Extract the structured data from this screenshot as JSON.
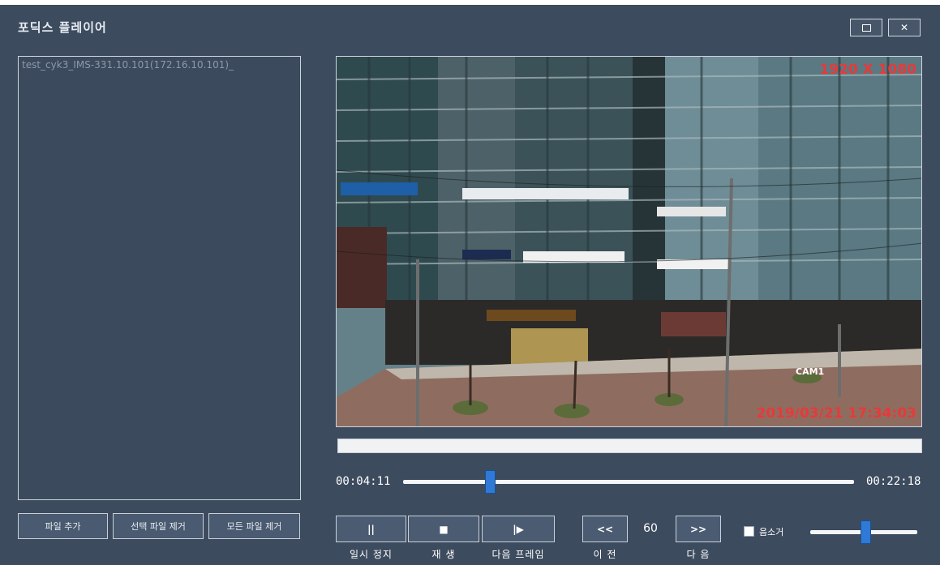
{
  "window": {
    "title": "포딕스 플레이어",
    "maximize_icon": "maximize-icon",
    "close_icon": "close-icon",
    "close_glyph": "✕"
  },
  "file_list": {
    "items": [
      "test_cyk3_IMS-331.10.101(172.16.10.101)_"
    ]
  },
  "file_buttons": {
    "add": "파일 추가",
    "remove_selected": "선택 파일 제거",
    "remove_all": "모든 파일 제거"
  },
  "video": {
    "resolution": "1920 X 1080",
    "timestamp": "2019/03/21 17:34:03",
    "camera_label": "CAM1"
  },
  "playback": {
    "current_time": "00:04:11",
    "total_time": "00:22:18",
    "seek_position_fraction": 0.188,
    "pause_glyph": "||",
    "stop_glyph": "■",
    "next_frame_glyph": "|▶",
    "prev_glyph": "<<",
    "next_glyph": ">>",
    "frame_step": "60",
    "labels": {
      "pause": "일시 정지",
      "play": "재 생",
      "next_frame": "다음 프레임",
      "prev": "이 전",
      "next": "다 음"
    }
  },
  "audio": {
    "mute_label": "음소거",
    "mute_checked": false,
    "volume_fraction": 0.5
  },
  "colors": {
    "window_bg": "#3d4b5e",
    "accent": "#2f7ad6",
    "overlay_red": "#e63a3a"
  }
}
